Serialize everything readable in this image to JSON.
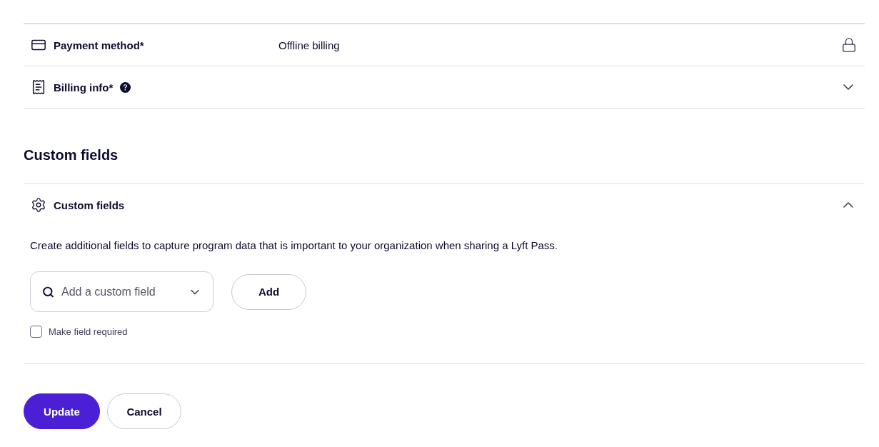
{
  "billing_rows": [
    {
      "kind": "value",
      "label": "Payment method*",
      "value": "Offline billing",
      "locked": true
    },
    {
      "kind": "expandable",
      "label": "Billing info*",
      "help": true,
      "expanded": false
    }
  ],
  "custom_fields": {
    "heading": "Custom fields",
    "panel": {
      "title": "Custom fields",
      "expanded": true,
      "description": "Create additional fields to capture program data that is important to your organization when sharing a Lyft Pass.",
      "select": {
        "placeholder": "Add a custom field"
      },
      "add_button": "Add",
      "required_checkbox": {
        "label": "Make field required",
        "checked": false
      }
    }
  },
  "actions": [
    {
      "label": "Update",
      "kind": "primary"
    },
    {
      "label": "Cancel",
      "kind": "secondary"
    }
  ]
}
